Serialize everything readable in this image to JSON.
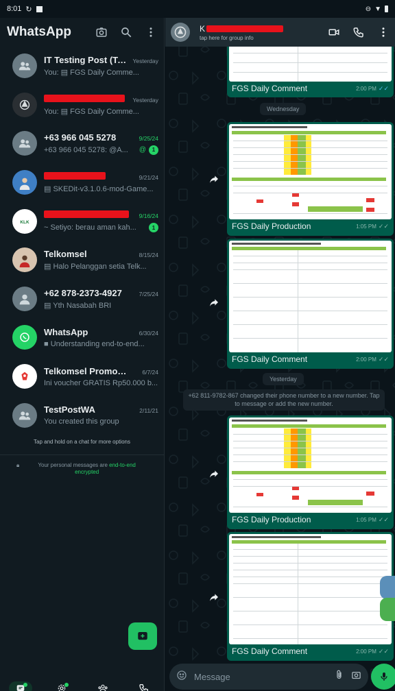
{
  "status_bar": {
    "time": "8:01"
  },
  "left_header": {
    "title": "WhatsApp"
  },
  "chats": [
    {
      "name": "IT Testing Post (Te...",
      "time": "Yesterday",
      "preview": "You: ▤ FGS Daily Comme...",
      "time_green": false,
      "redacted": false,
      "avatar": "group"
    },
    {
      "name": "",
      "time": "Yesterday",
      "preview": "You: ▤ FGS Daily Comme...",
      "time_green": false,
      "redacted": true,
      "avatar": "logo"
    },
    {
      "name": "+63 966 045 5278",
      "time": "9/25/24",
      "preview": "+63 966 045 5278: @A...",
      "time_green": true,
      "redacted": false,
      "avatar": "group",
      "mention": "@",
      "badge": "1"
    },
    {
      "name": "",
      "time": "9/21/24",
      "preview": "▤ SKEDit-v3.1.0.6-mod-Game...",
      "time_green": false,
      "redacted": true,
      "avatar": "photo"
    },
    {
      "name": "",
      "time": "9/16/24",
      "preview": "~ Setiyo: berau aman kah...",
      "time_green": true,
      "redacted": true,
      "avatar": "klk",
      "badge": "1"
    },
    {
      "name": "Telkomsel",
      "time": "8/15/24",
      "preview": "▤ Halo Pelanggan setia Telk...",
      "time_green": false,
      "redacted": false,
      "avatar": "person"
    },
    {
      "name": "+62 878-2373-4927",
      "time": "7/25/24",
      "preview": "▤ Yth Nasabah BRI",
      "time_green": false,
      "redacted": false,
      "avatar": "user"
    },
    {
      "name": "WhatsApp",
      "time": "6/30/24",
      "preview": "■ Understanding end-to-end...",
      "time_green": false,
      "redacted": false,
      "avatar": "whatsapp"
    },
    {
      "name": "Telkomsel Promo & R...",
      "time": "6/7/24",
      "preview": "Ini voucher GRATIS Rp50.000 b...",
      "time_green": false,
      "redacted": false,
      "avatar": "promo"
    },
    {
      "name": "TestPostWA",
      "time": "2/11/21",
      "preview": "You created this group",
      "time_green": false,
      "redacted": false,
      "avatar": "group"
    }
  ],
  "hint": "Tap and hold on a chat for more options",
  "e2e": {
    "text": "Your personal messages are ",
    "link": "end-to-end encrypted"
  },
  "bottom_nav": [
    {
      "label": "Chats",
      "icon": "chats-icon",
      "active": true
    },
    {
      "label": "Updates",
      "icon": "updates-icon",
      "active": false
    },
    {
      "label": "Communi...",
      "icon": "communities-icon",
      "active": false
    },
    {
      "label": "Calls",
      "icon": "calls-icon",
      "active": false
    }
  ],
  "right_header": {
    "name": "K",
    "subtitle": "tap here for group info"
  },
  "messages": [
    {
      "caption": "FGS Daily Comment",
      "time": "2:00 PM",
      "read": true
    },
    {
      "caption": "FGS Daily Production",
      "time": "1:05 PM",
      "read": false
    },
    {
      "caption": "FGS Daily Comment",
      "time": "2:00 PM",
      "read": false
    },
    {
      "caption": "FGS Daily Production",
      "time": "1:05 PM",
      "read": false
    },
    {
      "caption": "FGS Daily Comment",
      "time": "2:00 PM",
      "read": false
    }
  ],
  "date_pills": [
    "Wednesday",
    "Yesterday"
  ],
  "system_message": "+62 811-9782-867 changed their phone number to a new number. Tap to message or add the new number.",
  "input": {
    "placeholder": "Message"
  },
  "colors": {
    "accent": "#25d366",
    "bubble": "#005c4b",
    "background": "#0b141a"
  }
}
